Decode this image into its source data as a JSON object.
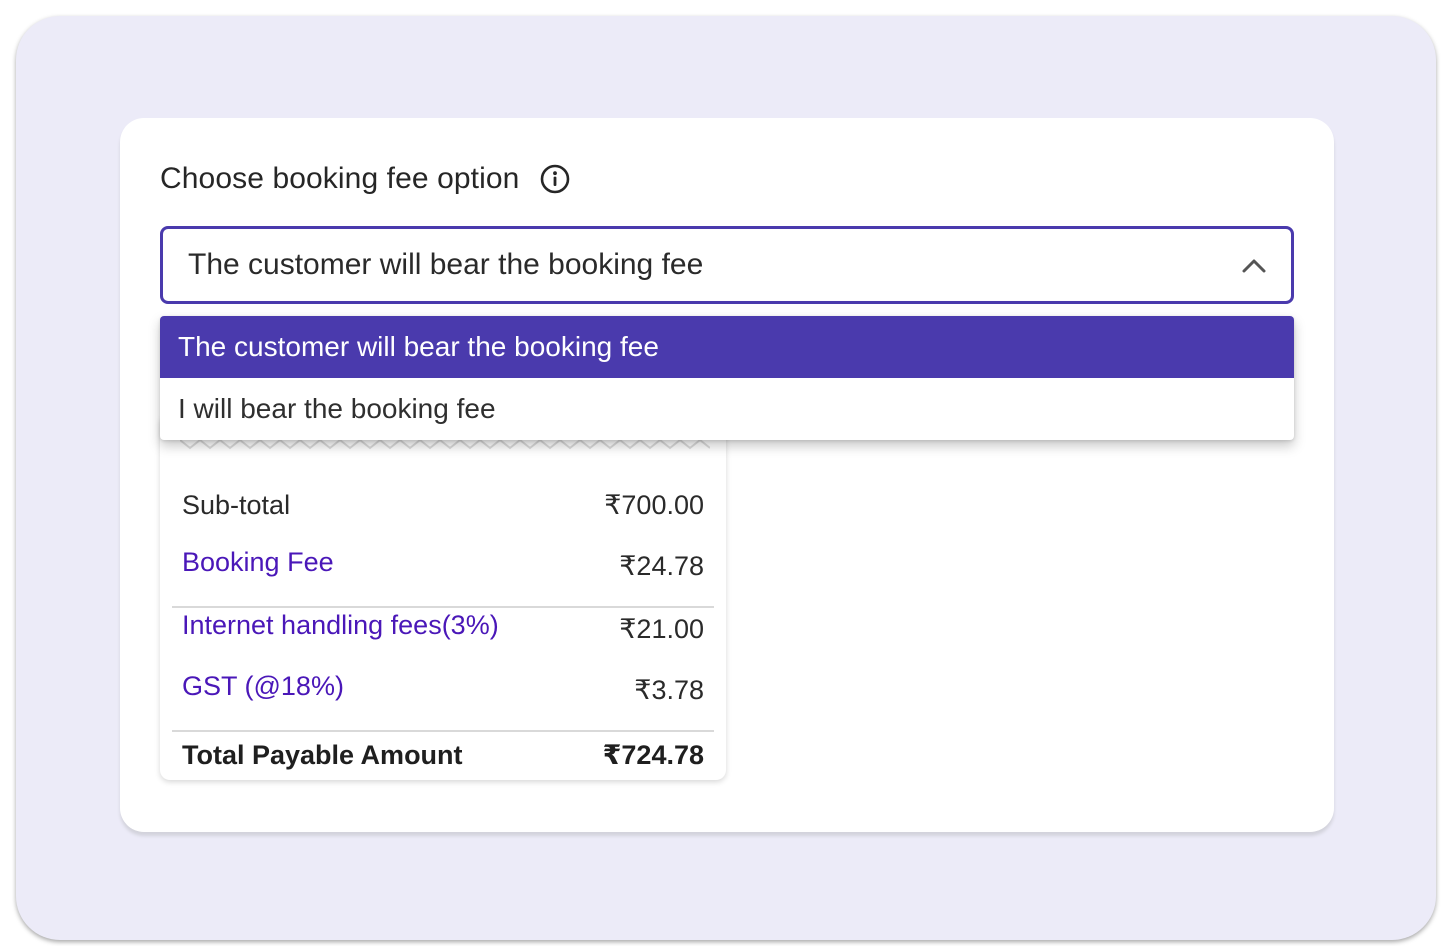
{
  "fee_option": {
    "label": "Choose booking fee option",
    "info_icon": "info-icon",
    "selected_value": "The customer will bear the booking fee",
    "options": [
      "The customer will bear the booking fee",
      "I will bear the booking fee"
    ]
  },
  "summary": {
    "subtotal_label": "Sub-total",
    "subtotal_value": "₹700.00",
    "booking_fee_label": "Booking Fee",
    "booking_fee_value": "₹24.78",
    "internet_fee_label": "Internet handling fees(3%)",
    "internet_fee_value": "₹21.00",
    "gst_label": "GST (@18%)",
    "gst_value": "₹3.78",
    "total_label": "Total Payable Amount",
    "total_value": "₹724.78"
  },
  "colors": {
    "accent": "#4a3aad",
    "link": "#4a17b8",
    "frame_bg": "#ecebf8"
  }
}
